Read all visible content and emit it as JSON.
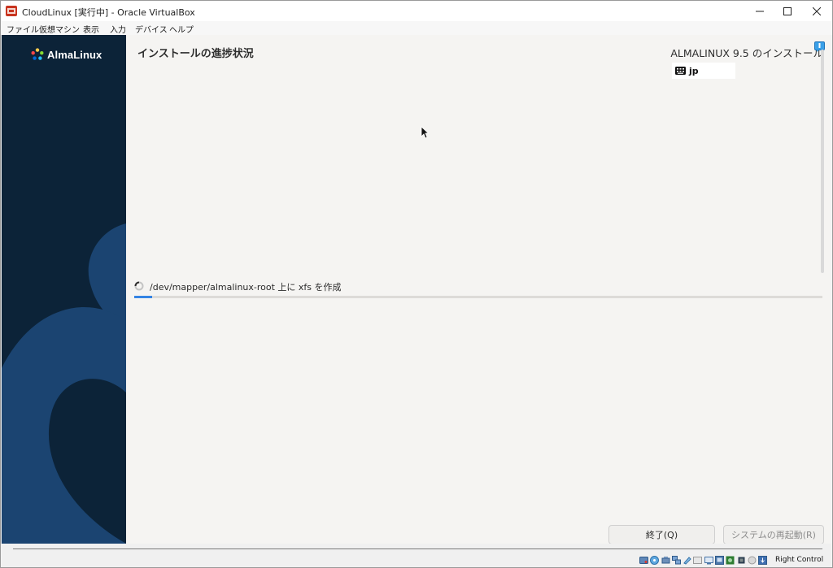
{
  "window": {
    "title": "CloudLinux [実行中] - Oracle VirtualBox"
  },
  "menu": [
    "ファイル",
    "仮想マシン",
    "表示",
    "入力",
    "デバイス",
    "ヘルプ"
  ],
  "installer": {
    "logo_text": "AlmaLinux",
    "page_title": "インストールの進捗状況",
    "product_title": "ALMALINUX 9.5 のインストール",
    "keyboard_layout": "jp",
    "status_text": "/dev/mapper/almalinux-root 上に xfs を作成",
    "progress_fraction": 0.026,
    "quit_label": "終了(Q)",
    "reboot_label": "システムの再起動(R)"
  },
  "statusbar": {
    "host_key": "Right Control"
  },
  "colors": {
    "sidebar": "#0c2338",
    "sidebar_shape": "#1b4471",
    "progress": "#3584e4"
  }
}
